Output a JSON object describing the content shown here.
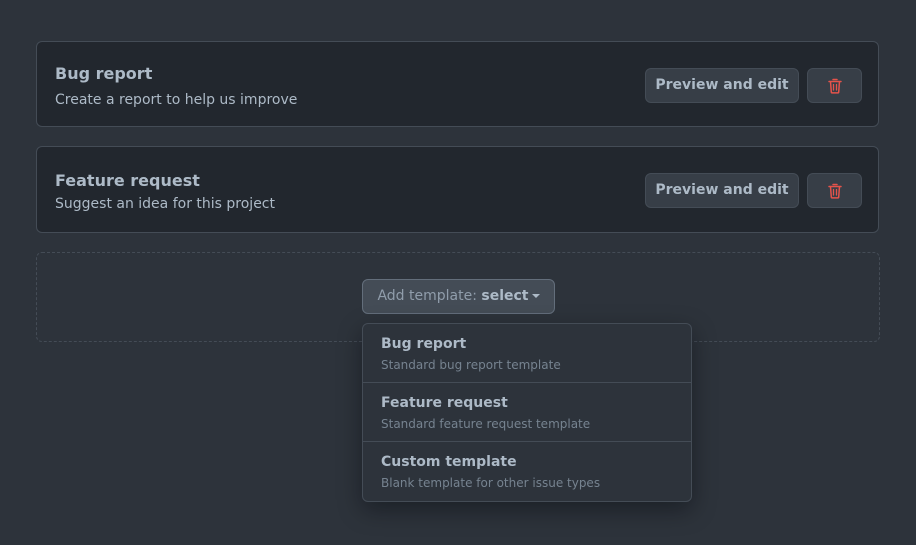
{
  "templates": [
    {
      "title": "Bug report",
      "description": "Create a report to help us improve",
      "edit_label": "Preview and edit",
      "delete_icon": "trash-icon"
    },
    {
      "title": "Feature request",
      "description": "Suggest an idea for this project",
      "edit_label": "Preview and edit",
      "delete_icon": "trash-icon"
    }
  ],
  "add_template": {
    "label": "Add template:",
    "selected": "select",
    "options": [
      {
        "title": "Bug report",
        "description": "Standard bug report template"
      },
      {
        "title": "Feature request",
        "description": "Standard feature request template"
      },
      {
        "title": "Custom template",
        "description": "Blank template for other issue types"
      }
    ]
  },
  "colors": {
    "background": "#2d333b",
    "card": "#22272e",
    "border": "#444c56",
    "text": "#adbac7",
    "muted": "#768390",
    "danger": "#e5534b"
  }
}
